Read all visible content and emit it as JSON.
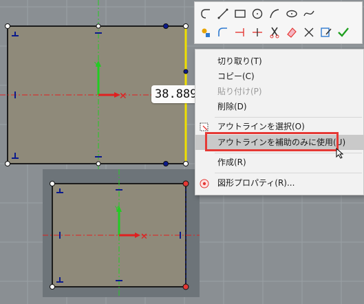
{
  "canvas": {
    "background": "#8a8f93",
    "sketch_fill": "#8f8a7a",
    "outline_color": "#1c1c1c",
    "axis_color": "#e02020",
    "green_axis_color": "#22cc22",
    "highlight_color": "#e53935",
    "yellow_edge": "#f0e000"
  },
  "dimension": {
    "value": "38.889"
  },
  "toolbar": {
    "row1": [
      "polyline-icon",
      "line-icon",
      "rectangle-icon",
      "circle-icon",
      "arc-icon",
      "ellipse-icon",
      "spline-icon"
    ],
    "row2": [
      "point-icon",
      "fillet-icon",
      "offset-icon",
      "trim-icon",
      "cut-icon",
      "erase-icon",
      "detach-icon",
      "confirm-icon"
    ]
  },
  "context_menu": {
    "items": [
      {
        "label": "切り取り(T)",
        "disabled": false
      },
      {
        "label": "コピー(C)",
        "disabled": false
      },
      {
        "label": "貼り付け(P)",
        "disabled": true
      },
      {
        "label": "削除(D)",
        "disabled": false
      },
      {
        "label": "アウトラインを選択(O)",
        "disabled": false
      },
      {
        "label": "アウトラインを補助のみに使用(U)",
        "disabled": false,
        "hover": true
      },
      {
        "label": "作成(R)",
        "disabled": false
      },
      {
        "label": "図形プロパティ(R)...",
        "disabled": false
      }
    ]
  }
}
